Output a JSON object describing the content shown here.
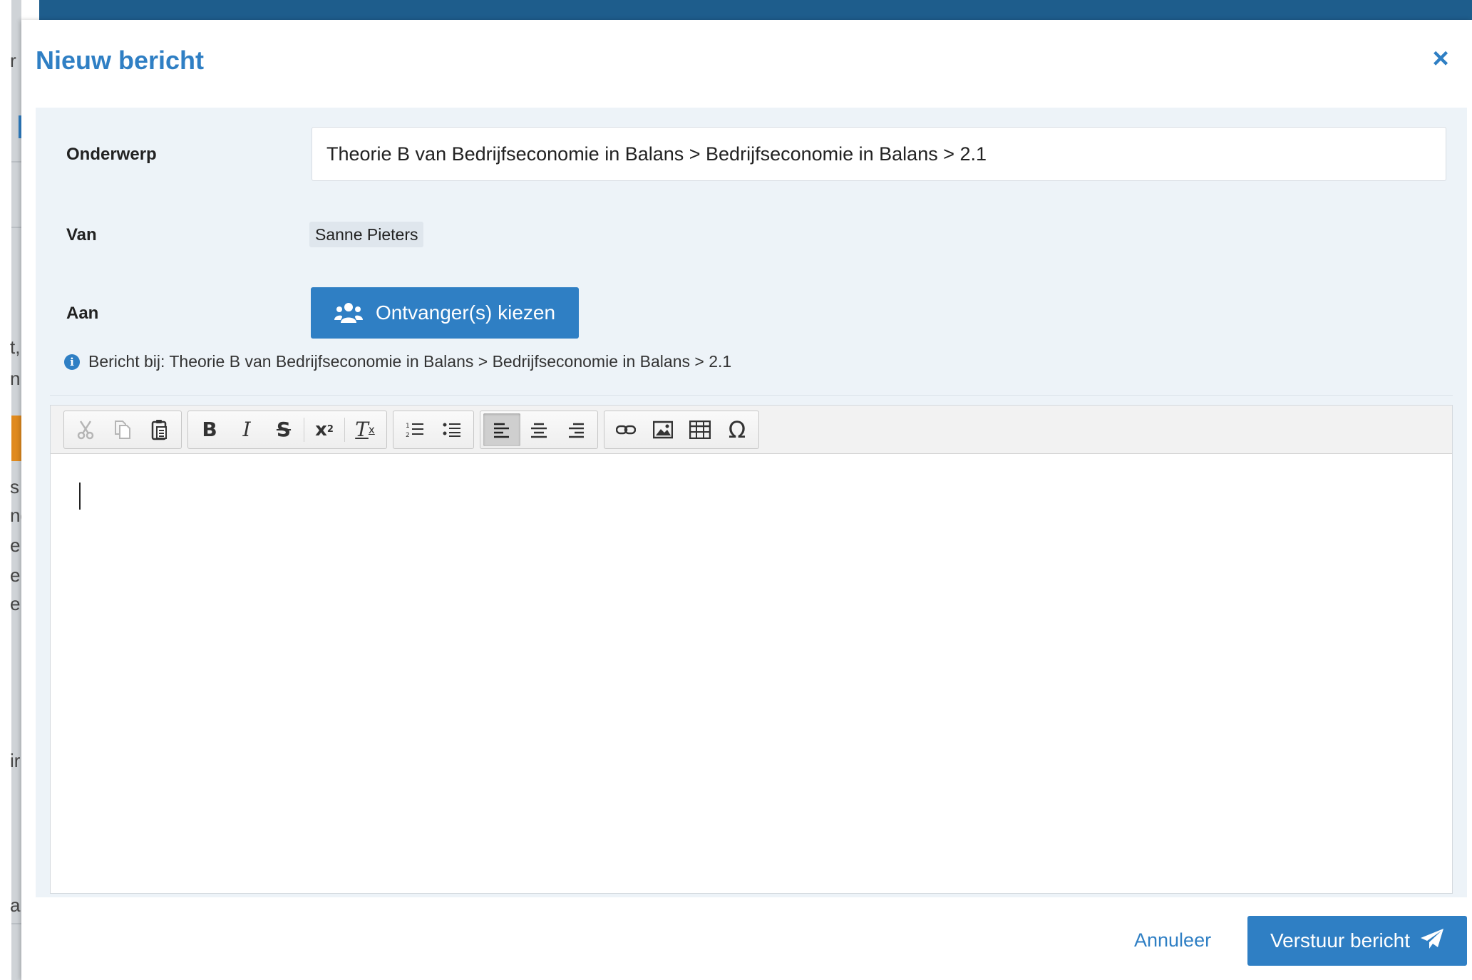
{
  "background": {
    "fragments": [
      "r",
      "t,",
      "n",
      "s",
      "ng",
      "e",
      "e",
      "e",
      "ir",
      "ar"
    ]
  },
  "dialog": {
    "title": "Nieuw bericht",
    "close_icon": "close-icon"
  },
  "form": {
    "subject_label": "Onderwerp",
    "subject_value": "Theorie B van Bedrijfseconomie in Balans > Bedrijfseconomie in Balans > 2.1",
    "from_label": "Van",
    "from_value": "Sanne Pieters",
    "to_label": "Aan",
    "recipients_button": "Ontvanger(s) kiezen",
    "context_note": "Bericht bij: Theorie B van Bedrijfseconomie in Balans > Bedrijfseconomie in Balans > 2.1"
  },
  "toolbar": {
    "bold": "B",
    "italic": "I",
    "strike": "S",
    "superscript_base": "x",
    "superscript_mark": "2",
    "clear_format": "T",
    "clear_format_sub": "x",
    "special_char": "Ω",
    "active_alignment": "left"
  },
  "editor": {
    "content": ""
  },
  "footer": {
    "cancel_label": "Annuleer",
    "send_label": "Verstuur bericht"
  },
  "colors": {
    "accent": "#2f7fc4",
    "panel": "#edf3f8",
    "topbar": "#1e5d8c"
  }
}
